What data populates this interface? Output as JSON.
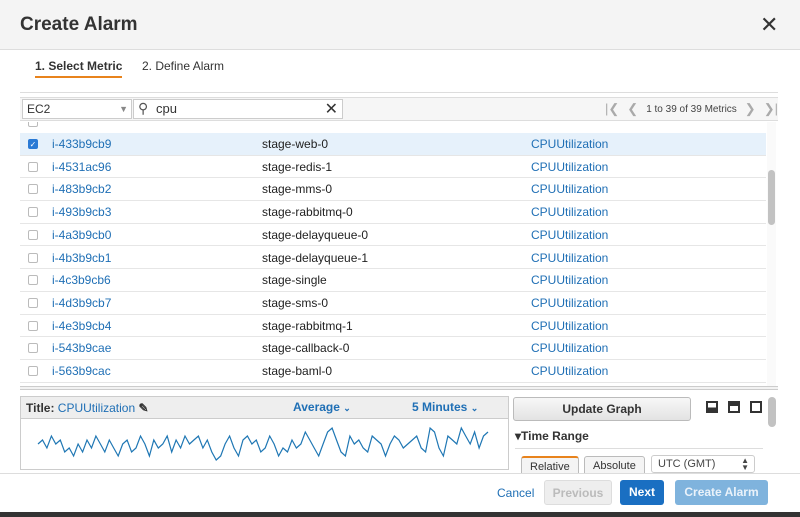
{
  "dialog": {
    "title": "Create Alarm",
    "close_icon": "close-icon"
  },
  "tabs": [
    {
      "label": "1. Select Metric",
      "active": true
    },
    {
      "label": "2. Define Alarm",
      "active": false
    }
  ],
  "toolbar": {
    "namespace": "EC2",
    "search_value": "cpu",
    "pagination": "1 to 39 of 39 Metrics"
  },
  "rows": [
    {
      "id": "i-433b9cb9",
      "name": "stage-web-0",
      "metric": "CPUUtilization",
      "checked": true
    },
    {
      "id": "i-4531ac96",
      "name": "stage-redis-1",
      "metric": "CPUUtilization",
      "checked": false
    },
    {
      "id": "i-483b9cb2",
      "name": "stage-mms-0",
      "metric": "CPUUtilization",
      "checked": false
    },
    {
      "id": "i-493b9cb3",
      "name": "stage-rabbitmq-0",
      "metric": "CPUUtilization",
      "checked": false
    },
    {
      "id": "i-4a3b9cb0",
      "name": "stage-delayqueue-0",
      "metric": "CPUUtilization",
      "checked": false
    },
    {
      "id": "i-4b3b9cb1",
      "name": "stage-delayqueue-1",
      "metric": "CPUUtilization",
      "checked": false
    },
    {
      "id": "i-4c3b9cb6",
      "name": "stage-single",
      "metric": "CPUUtilization",
      "checked": false
    },
    {
      "id": "i-4d3b9cb7",
      "name": "stage-sms-0",
      "metric": "CPUUtilization",
      "checked": false
    },
    {
      "id": "i-4e3b9cb4",
      "name": "stage-rabbitmq-1",
      "metric": "CPUUtilization",
      "checked": false
    },
    {
      "id": "i-543b9cae",
      "name": "stage-callback-0",
      "metric": "CPUUtilization",
      "checked": false
    },
    {
      "id": "i-563b9cac",
      "name": "stage-baml-0",
      "metric": "CPUUtilization",
      "checked": false
    }
  ],
  "graph": {
    "title_label": "Title:",
    "title": "CPUUtilization",
    "statistic": "Average",
    "period": "5 Minutes",
    "color": "#1f77b4",
    "sparkline": [
      5,
      6,
      4,
      7,
      5,
      6,
      3,
      4,
      2,
      5,
      3,
      6,
      4,
      7,
      5,
      3,
      6,
      4,
      2,
      5,
      6,
      3,
      4,
      7,
      5,
      2,
      6,
      4,
      5,
      7,
      3,
      6,
      4,
      7,
      5,
      6,
      7,
      4,
      6,
      3,
      1,
      2,
      5,
      7,
      4,
      2,
      6,
      7,
      5,
      6,
      3,
      4,
      7,
      5,
      2,
      4,
      3,
      6,
      4,
      5,
      8,
      6,
      4,
      2,
      5,
      8,
      9,
      6,
      3,
      2,
      7,
      5,
      6,
      4,
      3,
      7,
      6,
      5,
      2,
      5,
      7,
      6,
      4,
      5,
      6,
      7,
      4,
      3,
      9,
      8,
      4,
      2,
      7,
      6,
      5,
      9,
      7,
      5,
      8,
      4,
      7,
      8
    ]
  },
  "right_panel": {
    "update_button": "Update Graph",
    "time_range": "Time Range",
    "relative": "Relative",
    "absolute": "Absolute",
    "timezone": "UTC (GMT)"
  },
  "footer": {
    "cancel": "Cancel",
    "previous": "Previous",
    "next": "Next",
    "create": "Create Alarm"
  }
}
